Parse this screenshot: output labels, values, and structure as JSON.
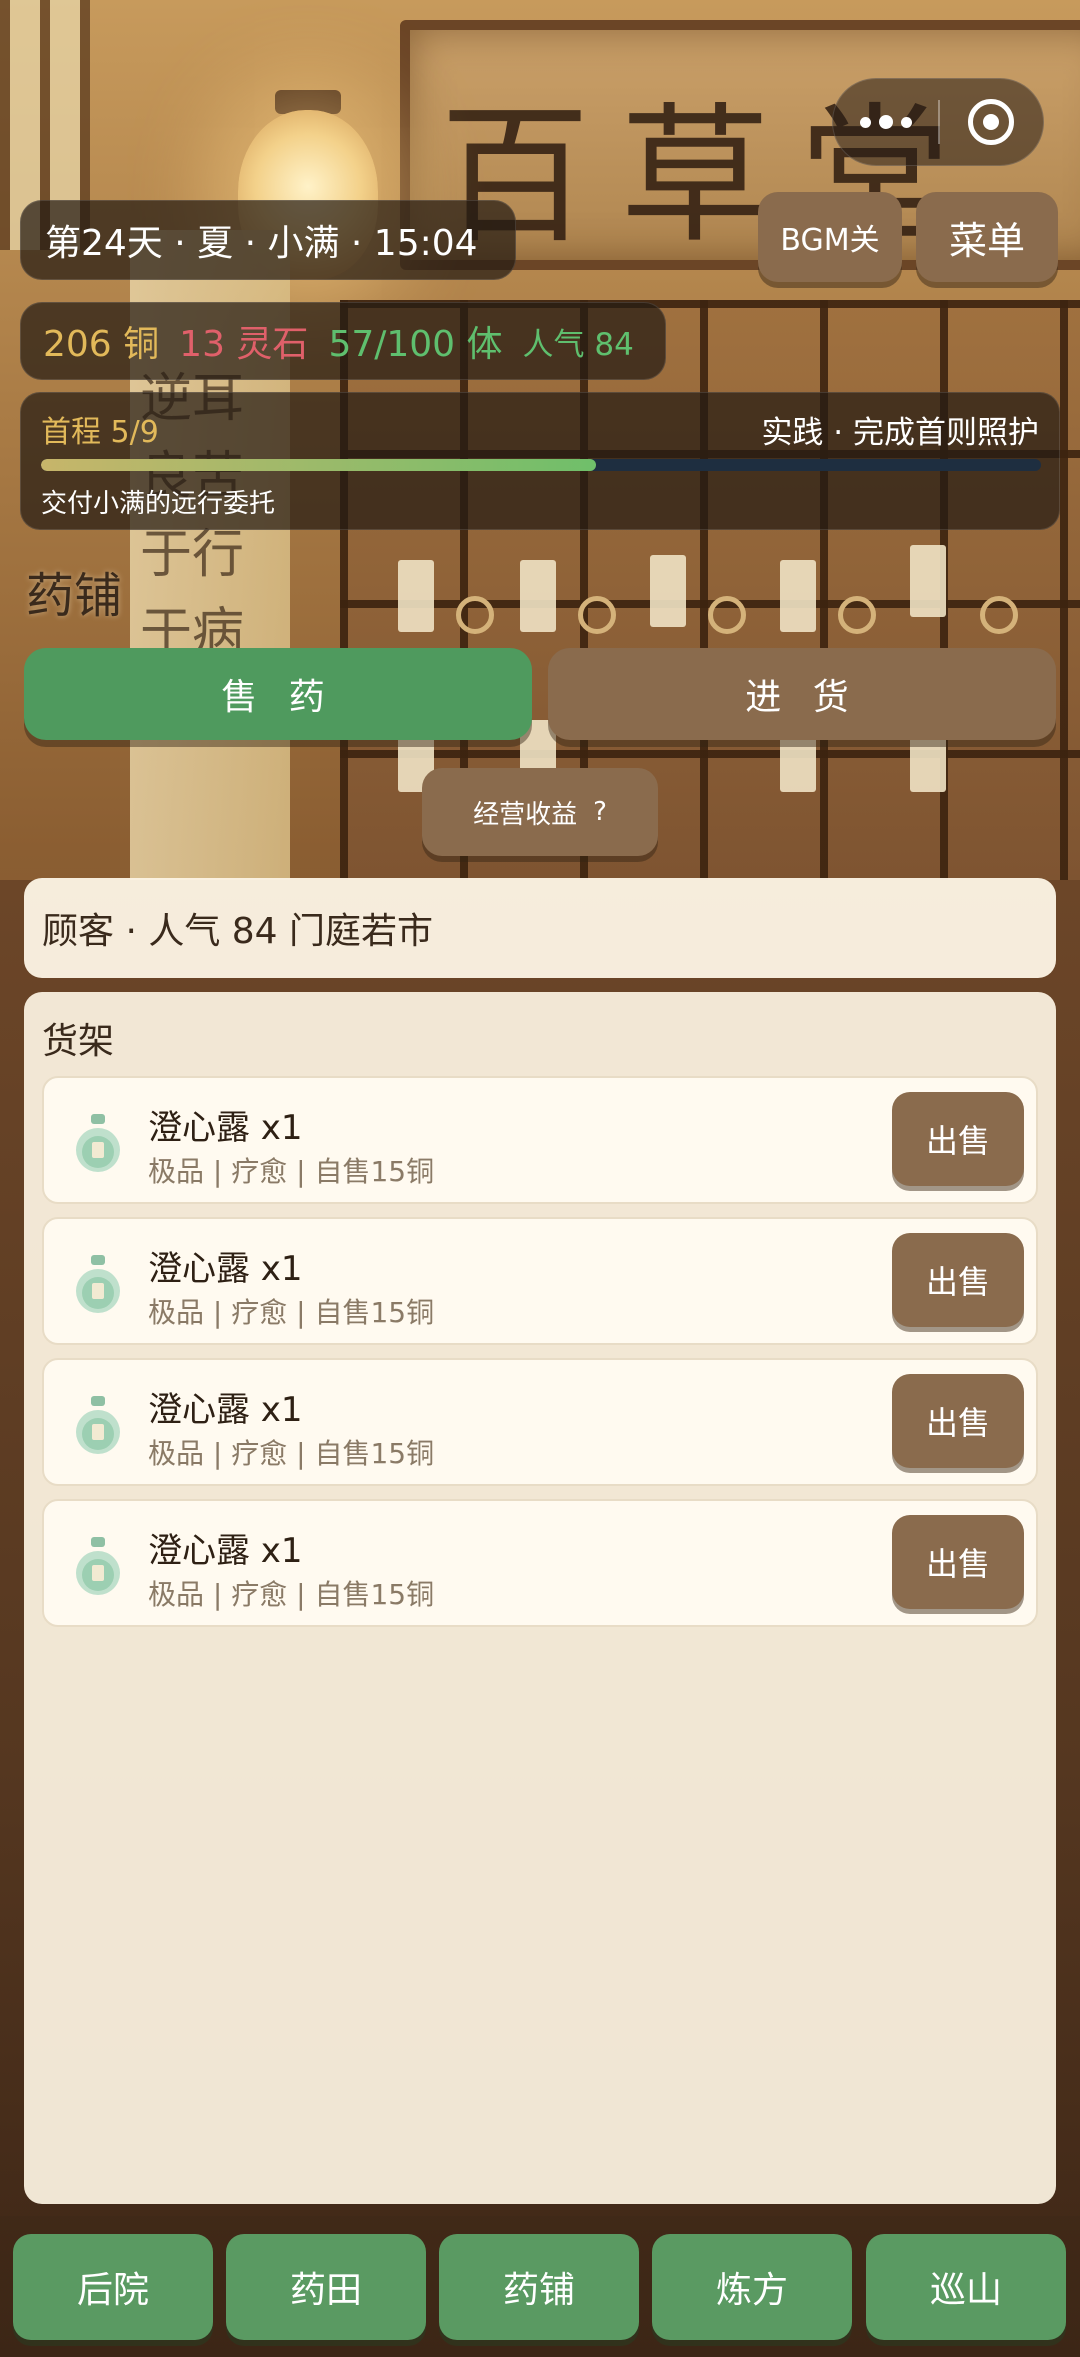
{
  "background": {
    "sign_text": "百草堂",
    "pillar_text": "逆耳 良苦 于行 于病"
  },
  "hud": {
    "time_text": "第24天 · 夏 · 小满 · 15:04",
    "copper": "206 铜",
    "spirit_stone": "13 灵石",
    "stamina": "57/100 体",
    "popularity": "人气 84",
    "bgm_label": "BGM关",
    "menu_label": "菜单"
  },
  "quest": {
    "step": "首程 5/9",
    "title": "实践 · 完成首则照护",
    "description": "交付小满的远行委托",
    "progress": 0.555
  },
  "shop": {
    "title": "药铺",
    "tabs": [
      {
        "label": "售 药",
        "active": true
      },
      {
        "label": "进 货",
        "active": false
      }
    ],
    "income_label": "经营收益",
    "income_help": "?",
    "customer_text": "顾客 · 人气 84 门庭若市",
    "shelf_title": "货架",
    "items": [
      {
        "name": "澄心露 x1",
        "meta": "极品 | 疗愈 | 自售15铜",
        "action": "出售"
      },
      {
        "name": "澄心露 x1",
        "meta": "极品 | 疗愈 | 自售15铜",
        "action": "出售"
      },
      {
        "name": "澄心露 x1",
        "meta": "极品 | 疗愈 | 自售15铜",
        "action": "出售"
      },
      {
        "name": "澄心露 x1",
        "meta": "极品 | 疗愈 | 自售15铜",
        "action": "出售"
      }
    ]
  },
  "nav": {
    "items": [
      "后院",
      "药田",
      "药铺",
      "炼方",
      "巡山"
    ]
  },
  "colors": {
    "accent_green": "#4f9a5e",
    "button_brown": "#8a6b4d",
    "copper_gold": "#e2b95a",
    "stone_red": "#e0606a",
    "stamina_green": "#5fbf6e"
  },
  "icons": {
    "capsule_more": "more-dots-icon",
    "capsule_close": "target-circle-icon",
    "item": "potion-bottle-icon"
  }
}
